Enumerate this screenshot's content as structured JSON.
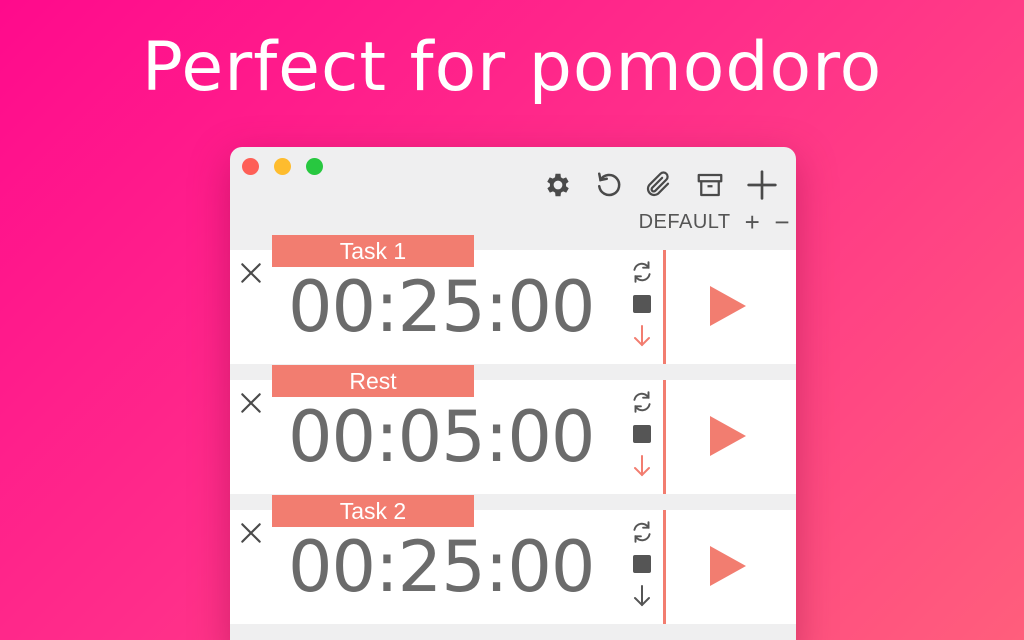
{
  "headline": "Perfect for pomodoro",
  "window": {
    "traffic_lights": [
      {
        "name": "close",
        "color": "#fe5f57"
      },
      {
        "name": "minimize",
        "color": "#febc2e"
      },
      {
        "name": "zoom",
        "color": "#28c840"
      }
    ],
    "toolbar": [
      "gear-icon",
      "reset-icon",
      "paperclip-icon",
      "archive-icon",
      "plus-icon"
    ],
    "profile": {
      "name": "DEFAULT",
      "add": "+",
      "remove": "−"
    }
  },
  "colors": {
    "accent": "#f27d70",
    "time_text": "#6b6b6b",
    "icon_gray": "#4a4a4a"
  },
  "timers": [
    {
      "label": "Task 1",
      "time": "00:25:00",
      "arrow_color": "#f27d70"
    },
    {
      "label": "Rest",
      "time": "00:05:00",
      "arrow_color": "#f27d70"
    },
    {
      "label": "Task 2",
      "time": "00:25:00",
      "arrow_color": "#555555"
    }
  ]
}
